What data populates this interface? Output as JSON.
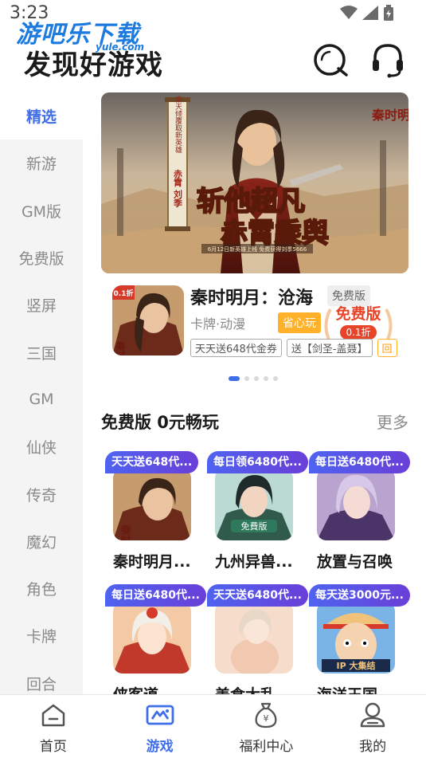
{
  "status_bar": {
    "time": "3:23"
  },
  "watermark": {
    "brand": "游吧乐下载",
    "domain": "yule.com"
  },
  "header": {
    "title": "发现好游戏",
    "search_icon": "search-icon",
    "service_icon": "headset-icon"
  },
  "sidebar": {
    "items": [
      {
        "label": "精选",
        "active": true
      },
      {
        "label": "新游"
      },
      {
        "label": "GM版"
      },
      {
        "label": "免费版"
      },
      {
        "label": "竖屏"
      },
      {
        "label": "三国"
      },
      {
        "label": "GM"
      },
      {
        "label": "仙侠"
      },
      {
        "label": "传奇"
      },
      {
        "label": "魔幻"
      },
      {
        "label": "角色"
      },
      {
        "label": "卡牌"
      },
      {
        "label": "回合"
      }
    ]
  },
  "banner": {
    "text_main": "斩他超凡 赤霄乘舆",
    "scroll_text": "秦天倾覆 取新英雄 赤霄 刘季",
    "footer_text": "6月12日新英雄上线 免费获得刘季5666",
    "logo": "秦时明月"
  },
  "featured_game": {
    "name": "秦时明月：沧海",
    "badge": "免费版",
    "meta": "卡牌·动漫",
    "tag": "省心玩",
    "stamp_title": "免费版",
    "stamp_sub": "0.1折",
    "icon_badge": "0.1折",
    "welfare": [
      "天天送648代金券",
      "送【剑圣-盖聂】",
      "回"
    ]
  },
  "carousel": {
    "count": 6,
    "active_index": 0
  },
  "section": {
    "title": "免费版 0元畅玩",
    "more": "更多"
  },
  "grid": [
    {
      "banner": "天天送648代...",
      "name": "秦时明月...",
      "colors": [
        "#d7a77a",
        "#5b3c2a"
      ]
    },
    {
      "banner": "每日领6480代...",
      "name": "九州异兽...",
      "colors": [
        "#9fc7c0",
        "#34453f"
      ]
    },
    {
      "banner": "每日送6480代...",
      "name": "放置与召唤",
      "colors": [
        "#b9a3cf",
        "#3d2e58"
      ]
    },
    {
      "banner": "每日送6480代...",
      "name": "侠客道",
      "colors": [
        "#f4c9a5",
        "#c0392b"
      ]
    },
    {
      "banner": "天天送6480代...",
      "name": "美食大乱...",
      "colors": [
        "#f6dccb",
        "#b68a73"
      ]
    },
    {
      "banner": "每天送3000元...",
      "name": "海洋王国",
      "colors": [
        "#f1c27a",
        "#2a4d8f"
      ]
    }
  ],
  "bottom_nav": [
    {
      "label": "首页",
      "icon": "home-icon"
    },
    {
      "label": "游戏",
      "icon": "gamepad-icon",
      "active": true
    },
    {
      "label": "福利中心",
      "icon": "money-bag-icon"
    },
    {
      "label": "我的",
      "icon": "profile-icon"
    }
  ],
  "colors": {
    "accent": "#3f6ee8",
    "orange": "#ffb12a",
    "badge_gradient_start": "#4f63f0",
    "badge_gradient_end": "#6a3fd8"
  }
}
